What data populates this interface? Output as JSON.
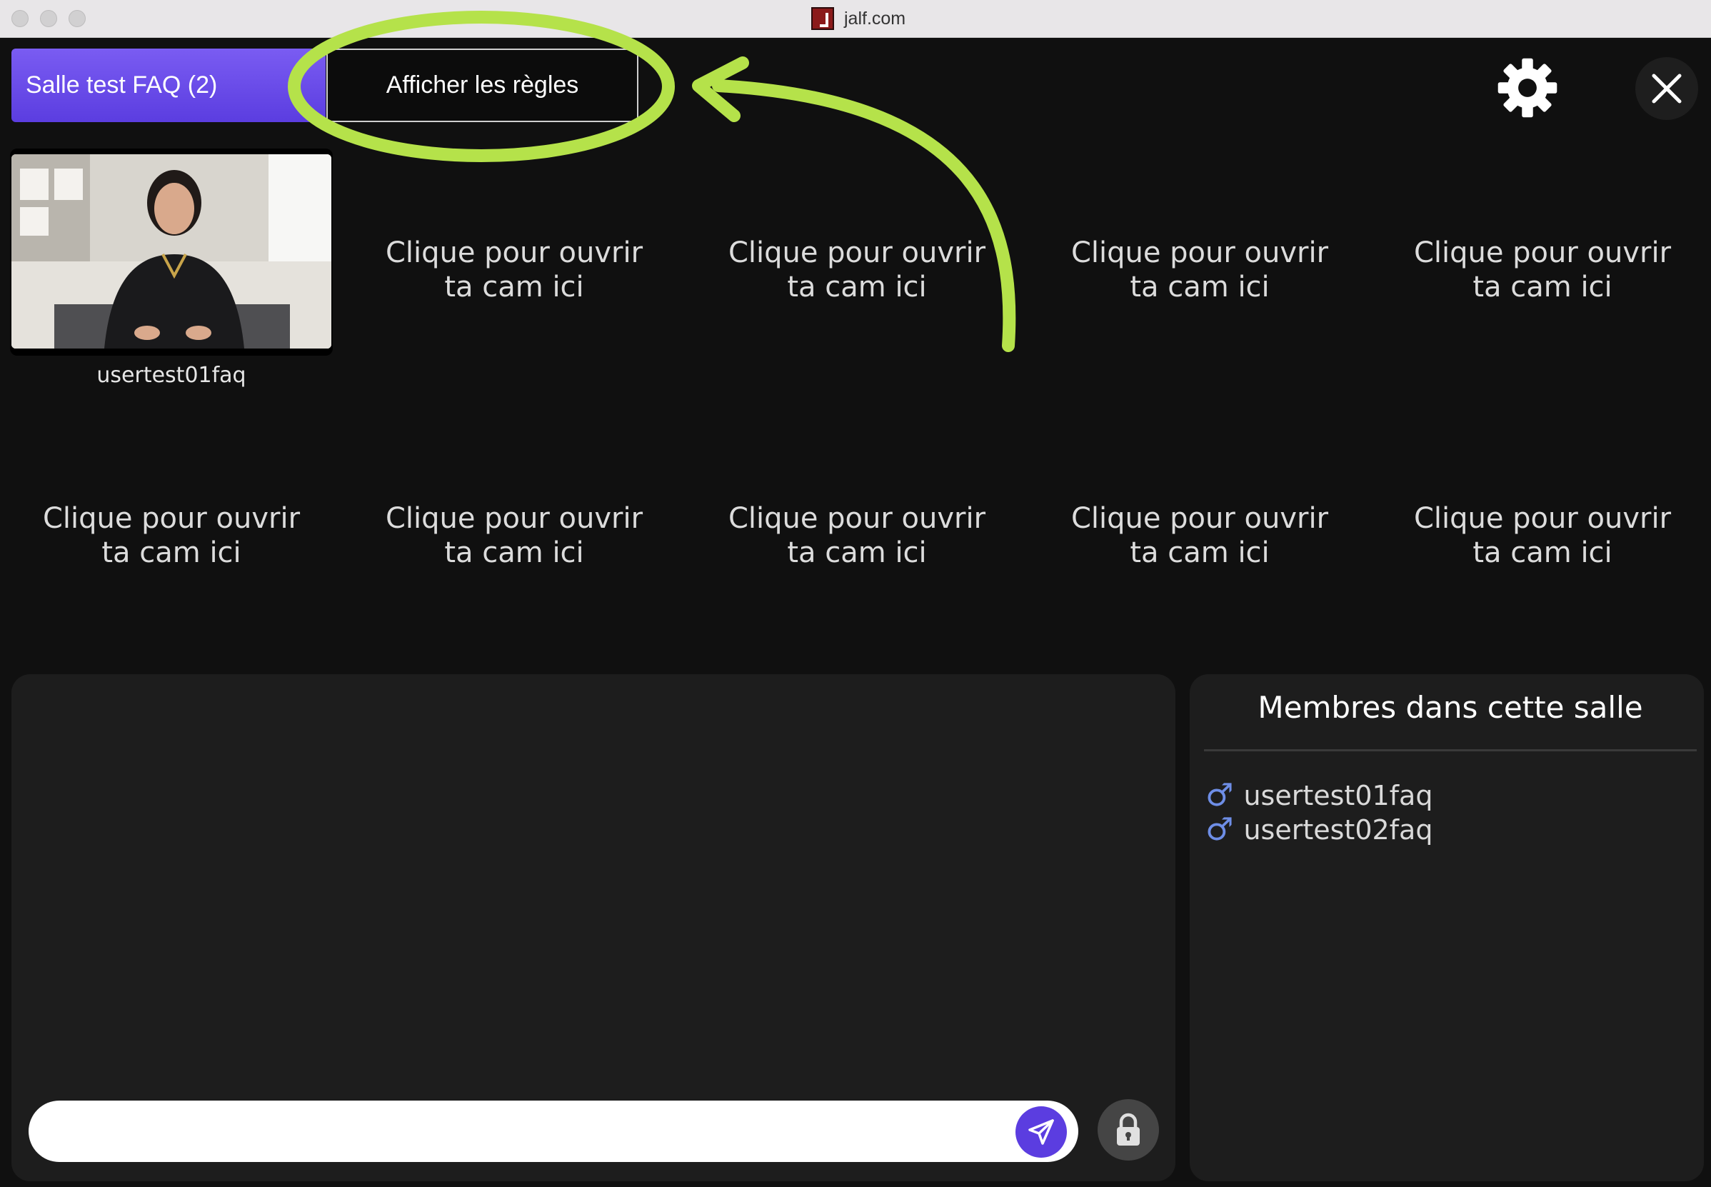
{
  "window": {
    "title": "jalf.com"
  },
  "toolbar": {
    "room_label": "Salle test FAQ (2)",
    "rules_label": "Afficher les règles"
  },
  "cams": {
    "active_user": "usertest01faq",
    "slot_text": "Clique pour ouvrir\nta cam ici"
  },
  "members": {
    "title": "Membres dans cette salle",
    "list": [
      {
        "name": "usertest01faq",
        "gender_icon": "male-icon"
      },
      {
        "name": "usertest02faq",
        "gender_icon": "male-icon"
      }
    ]
  },
  "chat": {
    "input_value": ""
  },
  "colors": {
    "accent": "#5b3de0",
    "annotation": "#b5e24a",
    "background": "#101010",
    "panel": "#1d1d1d",
    "member_icon": "#6e8ee6"
  }
}
